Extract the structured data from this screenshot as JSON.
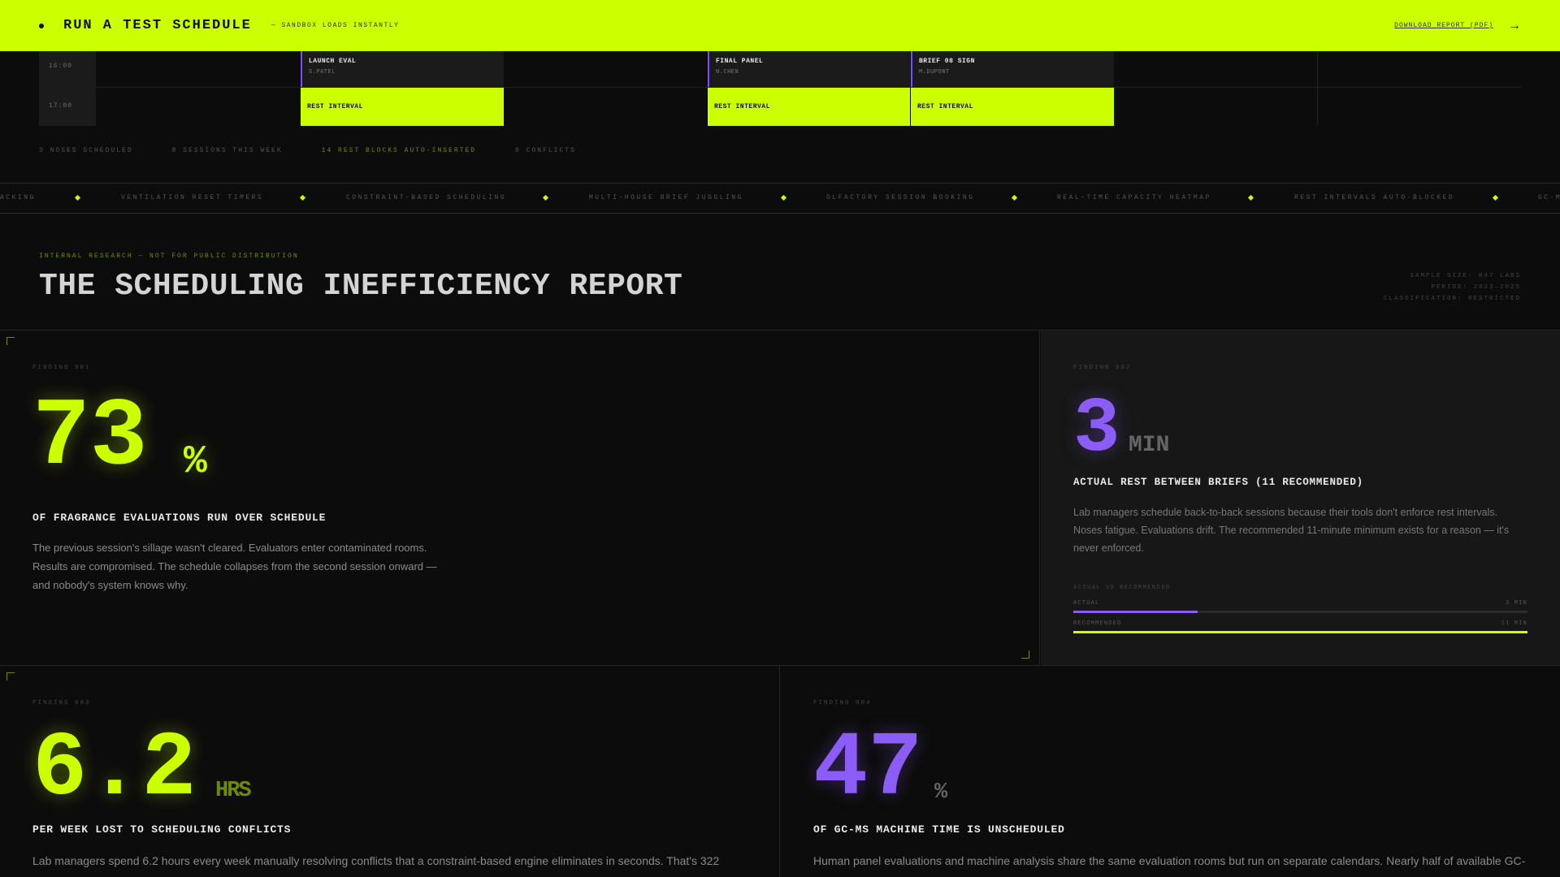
{
  "banner": {
    "title": "RUN A TEST SCHEDULE",
    "subtitle": "— SANDBOX LOADS INSTANTLY",
    "download_label": "DOWNLOAD REPORT (PDF)",
    "arrow": "→"
  },
  "schedule": {
    "times": [
      "16:00",
      "17:00"
    ],
    "sessions": [
      {
        "name": "LAUNCH EVAL",
        "who": "S.PATEL"
      },
      {
        "name": "FINAL PANEL",
        "who": "N.CHEN"
      },
      {
        "name": "BRIEF 08 SIGN",
        "who": "M.DUPONT"
      }
    ],
    "rest_label": "REST INTERVAL",
    "stats": [
      "3 NOSES SCHEDULED",
      "8 SESSIONS THIS WEEK",
      "14 REST BLOCKS AUTO-INSERTED",
      "0 CONFLICTS"
    ]
  },
  "ticker": {
    "items": [
      "ACKING",
      "VENTILATION RESET TIMERS",
      "CONSTRAINT-BASED SCHEDULING",
      "MULTI-HOUSE BRIEF JUGGLING",
      "OLFACTORY SESSION BOOKING",
      "REAL-TIME CAPACITY HEATMAP",
      "REST INTERVALS AUTO-BLOCKED",
      "GC-M"
    ]
  },
  "report": {
    "eyebrow": "INTERNAL RESEARCH — NOT FOR PUBLIC DISTRIBUTION",
    "title": "THE SCHEDULING INEFFICIENCY REPORT",
    "meta": [
      "SAMPLE SIZE: 847 LABS",
      "PERIOD: 2023–2025",
      "CLASSIFICATION: RESTRICTED"
    ]
  },
  "findings": {
    "f1": {
      "label": "FINDING 001",
      "number": "73",
      "unit": "%",
      "headline": "OF FRAGRANCE EVALUATIONS RUN OVER SCHEDULE",
      "body": [
        "The previous session's sillage wasn't cleared. Evaluators enter contaminated rooms.",
        "Results are compromised. The schedule collapses from the second session onward —",
        "and nobody's system knows why."
      ]
    },
    "f2": {
      "label": "FINDING 002",
      "number": "3",
      "unit": "MIN",
      "headline": "ACTUAL REST BETWEEN BRIEFS (11 RECOMMENDED)",
      "body": [
        "Lab managers schedule back-to-back sessions because their tools don't enforce rest intervals.",
        "Noses fatigue. Evaluations drift. The recommended 11-minute minimum exists for a reason — it's",
        "never enforced."
      ],
      "compare_label": "ACTUAL VS RECOMMENDED",
      "actual_label": "ACTUAL",
      "actual_value": "3 MIN",
      "recommended_label": "RECOMMENDED",
      "recommended_value": "11 MIN",
      "actual_fraction": 0.273,
      "recommended_fraction": 1.0
    },
    "f3": {
      "label": "FINDING 003",
      "number": "6.2",
      "unit": "HRS",
      "headline": "PER WEEK LOST TO SCHEDULING CONFLICTS",
      "body": [
        "Lab managers spend 6.2 hours every week manually resolving conflicts that a constraint-based engine eliminates in seconds. That's 322"
      ]
    },
    "f4": {
      "label": "FINDING 004",
      "number": "47",
      "unit": "%",
      "headline": "OF GC-MS MACHINE TIME IS UNSCHEDULED",
      "body": [
        "Human panel evaluations and machine analysis share the same evaluation rooms but run on separate calendars. Nearly half of available GC-"
      ]
    }
  },
  "colors": {
    "accent": "#ccff00",
    "purple": "#8b5cf6",
    "background": "#0c0c0c"
  }
}
